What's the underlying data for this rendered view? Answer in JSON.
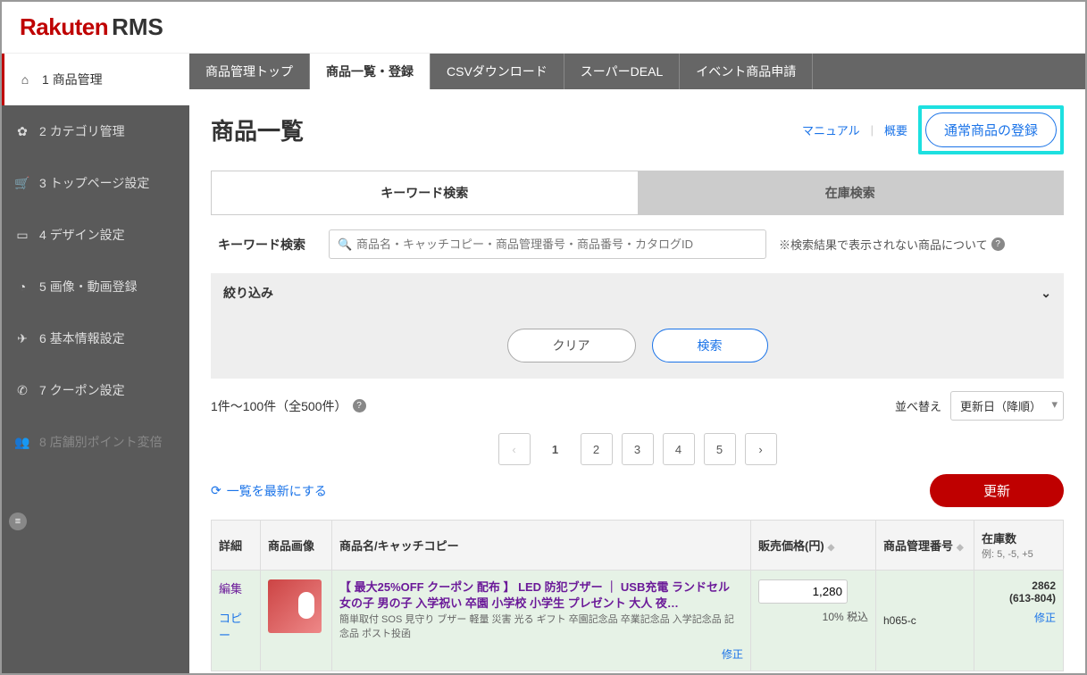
{
  "logo": {
    "brand": "Rakuten",
    "sub": "RMS"
  },
  "sidebar": {
    "items": [
      {
        "num": "1",
        "label": "商品管理",
        "icon": "⌂"
      },
      {
        "num": "2",
        "label": "カテゴリ管理",
        "icon": "✿"
      },
      {
        "num": "3",
        "label": "トップページ設定",
        "icon": "🛒"
      },
      {
        "num": "4",
        "label": "デザイン設定",
        "icon": "▭"
      },
      {
        "num": "5",
        "label": "画像・動画登録",
        "icon": "◔"
      },
      {
        "num": "6",
        "label": "基本情報設定",
        "icon": "✈"
      },
      {
        "num": "7",
        "label": "クーポン設定",
        "icon": "✆"
      },
      {
        "num": "8",
        "label": "店舗別ポイント変倍",
        "icon": "👥"
      }
    ]
  },
  "tabs": [
    "商品管理トップ",
    "商品一覧・登録",
    "CSVダウンロード",
    "スーパーDEAL",
    "イベント商品申請"
  ],
  "page": {
    "title": "商品一覧",
    "manual": "マニュアル",
    "overview": "概要",
    "register": "通常商品の登録"
  },
  "searchtabs": {
    "keyword": "キーワード検索",
    "stock": "在庫検索"
  },
  "search": {
    "label": "キーワード検索",
    "placeholder": "商品名・キャッチコピー・商品管理番号・商品番号・カタログID",
    "note": "※検索結果で表示されない商品について"
  },
  "filter": {
    "label": "絞り込み"
  },
  "buttons": {
    "clear": "クリア",
    "search": "検索"
  },
  "count": {
    "text": "1件〜100件（全500件）"
  },
  "sort": {
    "label": "並べ替え",
    "value": "更新日（降順）"
  },
  "pages": [
    "1",
    "2",
    "3",
    "4",
    "5"
  ],
  "refresh": {
    "link": "一覧を最新にする",
    "update": "更新"
  },
  "table": {
    "headers": {
      "detail": "詳細",
      "image": "商品画像",
      "name": "商品名/キャッチコピー",
      "price": "販売価格(円)",
      "sku": "商品管理番号",
      "stock": "在庫数",
      "stock_sub": "例: 5, -5, +5"
    },
    "rows": [
      {
        "edit": "編集",
        "copy": "コピー",
        "title": "【 最大25%OFF クーポン 配布 】 LED 防犯ブザー ｜ USB充電 ランドセル 女の子 男の子 入学祝い 卒園 小学校 小学生 プレゼント 大人 夜…",
        "desc": "簡単取付 SOS 見守り ブザー 軽量 災害 光る ギフト 卒園記念品 卒業記念品 入学記念品 記念品 ポスト投函",
        "fix": "修正",
        "price": "1,280",
        "tax": "10% 税込",
        "sku": "h065-c",
        "stock": "2862",
        "stock_detail": "(613-804)",
        "stock_fix": "修正"
      }
    ]
  }
}
